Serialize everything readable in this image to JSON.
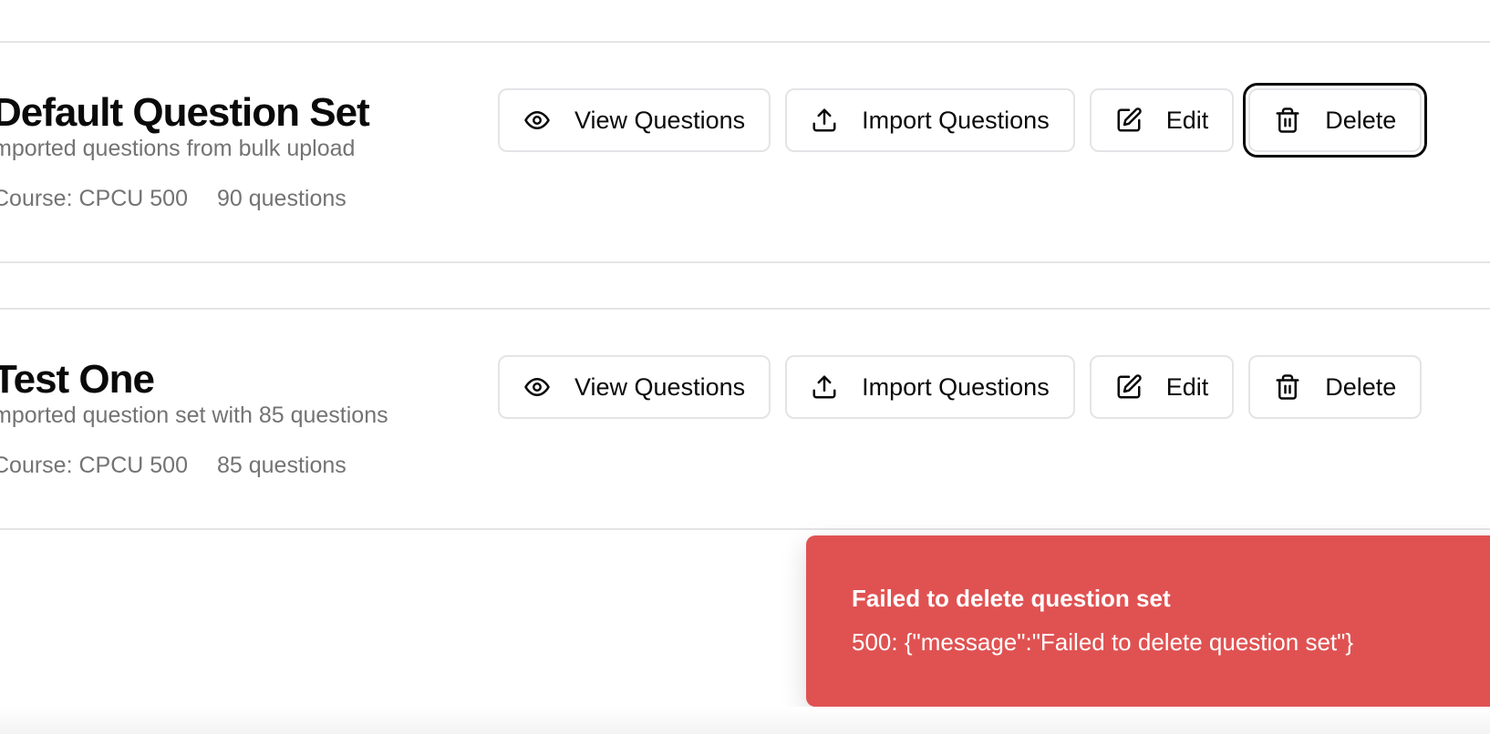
{
  "question_sets": [
    {
      "title": "Default Question Set",
      "description": "mported questions from bulk upload",
      "course": "Course: CPCU 500",
      "count": "90 questions",
      "buttons": {
        "view": "View Questions",
        "import": "Import Questions",
        "edit": "Edit",
        "delete": "Delete"
      }
    },
    {
      "title": "Test One",
      "description": "mported question set with 85 questions",
      "course": "Course: CPCU 500",
      "count": "85 questions",
      "buttons": {
        "view": "View Questions",
        "import": "Import Questions",
        "edit": "Edit",
        "delete": "Delete"
      }
    }
  ],
  "toast": {
    "title": "Failed to delete question set",
    "description": "500: {\"message\":\"Failed to delete question set\"}",
    "color": "#e05252"
  },
  "icons": {
    "view": "eye-icon",
    "import": "upload-icon",
    "edit": "edit-icon",
    "delete": "trash-icon"
  }
}
